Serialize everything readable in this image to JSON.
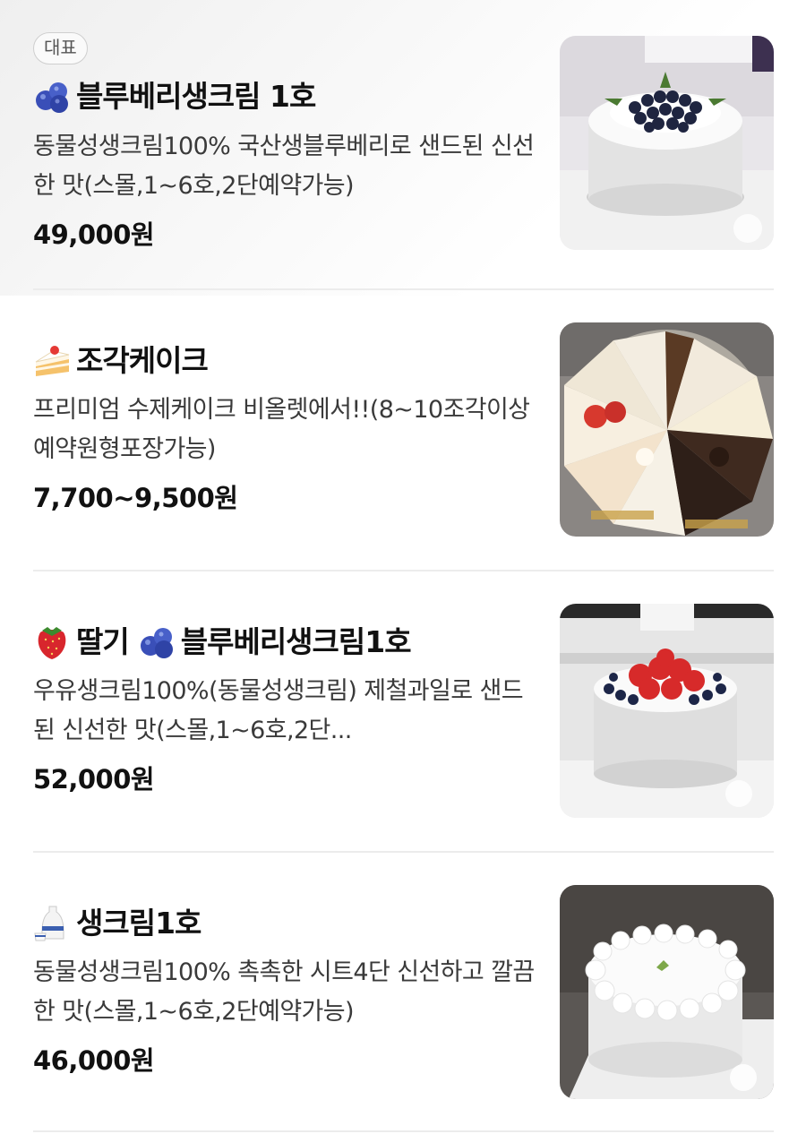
{
  "menu": [
    {
      "badge": "대표",
      "title": "블루베리생크림 1호",
      "title_icon": "blueberry-icon",
      "description": "동물성생크림100% 국산생블루베리로 샌드된 신선한 맛(스몰,1~6호,2단예약가능)",
      "price": "49,000원",
      "image": "blueberry-cream-cake-photo"
    },
    {
      "title": "조각케이크",
      "title_icon": "shortcake-icon",
      "description": "프리미엄 수제케이크 비올렛에서!!(8~10조각이상 예약원형포장가능)",
      "price": "7,700~9,500원",
      "image": "slice-cakes-photo"
    },
    {
      "title_prefix": "딸기",
      "title": "블루베리생크림1호",
      "title_prefix_icon": "strawberry-icon",
      "title_icon": "blueberry-icon",
      "description": "우유생크림100%(동물성생크림) 제철과일로 샌드된 신선한 맛(스몰,1~6호,2단...",
      "price": "52,000원",
      "image": "strawberry-blueberry-cake-photo"
    },
    {
      "title": "생크림1호",
      "title_icon": "sake-bottle-icon",
      "description": "동물성생크림100% 촉촉한 시트4단 신선하고 깔끔한 맛(스몰,1~6호,2단예약가능)",
      "price": "46,000원",
      "image": "fresh-cream-cake-photo"
    }
  ]
}
